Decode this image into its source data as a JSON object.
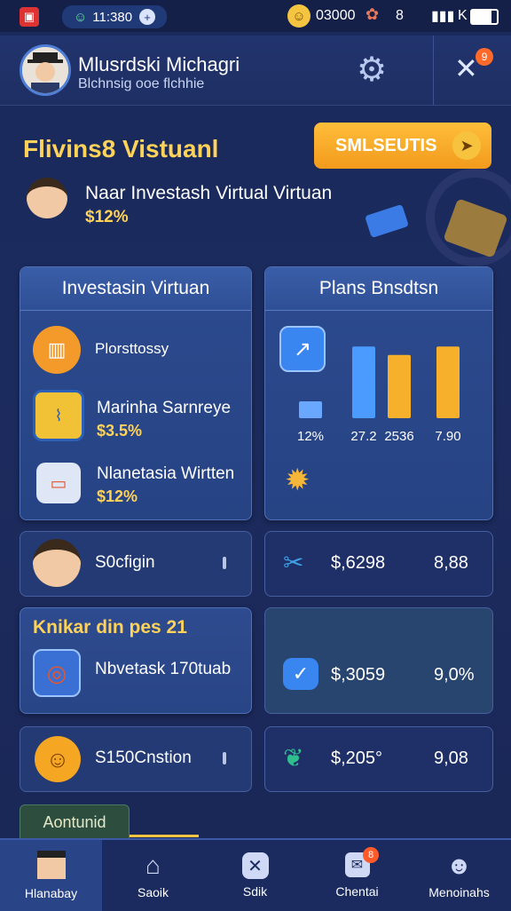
{
  "status": {
    "time": "11:380",
    "right_value": "03000",
    "signal_text": "8",
    "battery_text": "K"
  },
  "header": {
    "name": "Mlusrdski Michagri",
    "subtitle": "Blchnsig ooe flchhie"
  },
  "promo": {
    "title": "Flivins8 Vistuanl",
    "button_label": "SMLSEUTIS",
    "item_text": "Naar Investash Virtual Virtuan",
    "item_value": "$12%"
  },
  "left_card": {
    "title": "Investasin Virtuan",
    "items": [
      {
        "label": "Plorsttossy",
        "value": ""
      },
      {
        "label": "Marinha Sarnreye",
        "value": "$3.5%"
      },
      {
        "label": "Nlanetasia Wirtten",
        "value": "$12%"
      }
    ]
  },
  "right_card": {
    "title": "Plans Bnsdtsn",
    "bar_labels": [
      "12%",
      "27.2",
      "2536",
      "7.90"
    ]
  },
  "rows": [
    {
      "left_label": "S0cfigin",
      "right_value": "$,6298",
      "right_extra": "8,88"
    },
    {
      "section_title": "Knikar din pes 21",
      "left_label": "Nbvetask 170tuab",
      "right_value": "$,3059",
      "right_extra": "9,0%"
    },
    {
      "left_label": "S150Cnstion",
      "right_value": "$,205°",
      "right_extra": "9,08"
    }
  ],
  "bottom_tab": "Aontunid",
  "nav": [
    {
      "label": "Hlanabay"
    },
    {
      "label": "Saoik"
    },
    {
      "label": "Sdik"
    },
    {
      "label": "Chentai",
      "badge": "8"
    },
    {
      "label": "Menoinahs"
    }
  ],
  "colors": {
    "background": "#1a2a5c",
    "card": "#2c4a8e",
    "gold_text": "#f5c541",
    "button_orange": "#f6a623",
    "badge_red": "#e74c3c"
  },
  "chart_data": {
    "type": "bar",
    "title": "",
    "categories": [
      "12%",
      "27.2",
      "2536",
      "7.90"
    ],
    "values": [
      20,
      85,
      75,
      85
    ],
    "xlabel": "",
    "ylabel": "",
    "ylim": [
      0,
      100
    ]
  }
}
